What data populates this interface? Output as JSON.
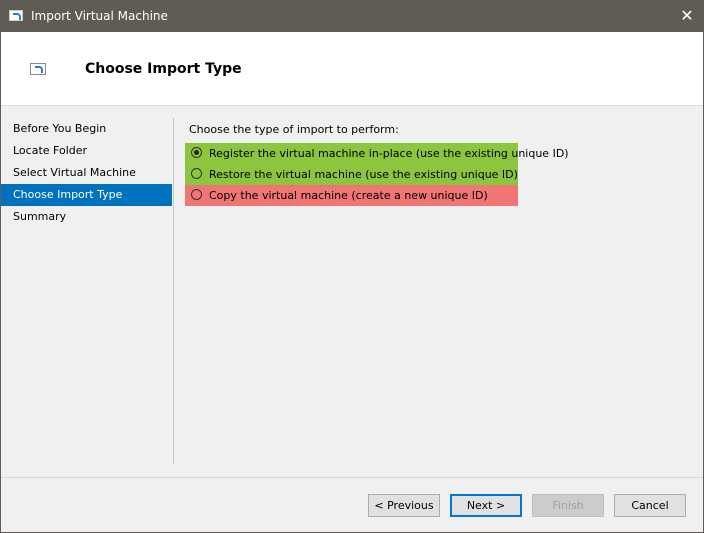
{
  "window": {
    "title": "Import Virtual Machine",
    "close_label": "✕"
  },
  "header": {
    "heading": "Choose Import Type"
  },
  "sidebar": {
    "items": [
      {
        "label": "Before You Begin",
        "active": false
      },
      {
        "label": "Locate Folder",
        "active": false
      },
      {
        "label": "Select Virtual Machine",
        "active": false
      },
      {
        "label": "Choose Import Type",
        "active": true
      },
      {
        "label": "Summary",
        "active": false
      }
    ]
  },
  "content": {
    "prompt": "Choose the type of import to perform:",
    "options": [
      {
        "label": "Register the virtual machine in-place (use the existing unique ID)",
        "selected": true,
        "highlight": "#8cc63f"
      },
      {
        "label": "Restore the virtual machine (use the existing unique ID)",
        "selected": false,
        "highlight": "#8cc63f"
      },
      {
        "label": "Copy the virtual machine (create a new unique ID)",
        "selected": false,
        "highlight": "#f07575"
      }
    ]
  },
  "buttons": {
    "previous": "< Previous",
    "next": "Next >",
    "finish": "Finish",
    "cancel": "Cancel"
  },
  "colors": {
    "titlebar": "#5f5b55",
    "accent": "#0071bc",
    "green_highlight": "#8cc63f",
    "red_highlight": "#f07575"
  }
}
